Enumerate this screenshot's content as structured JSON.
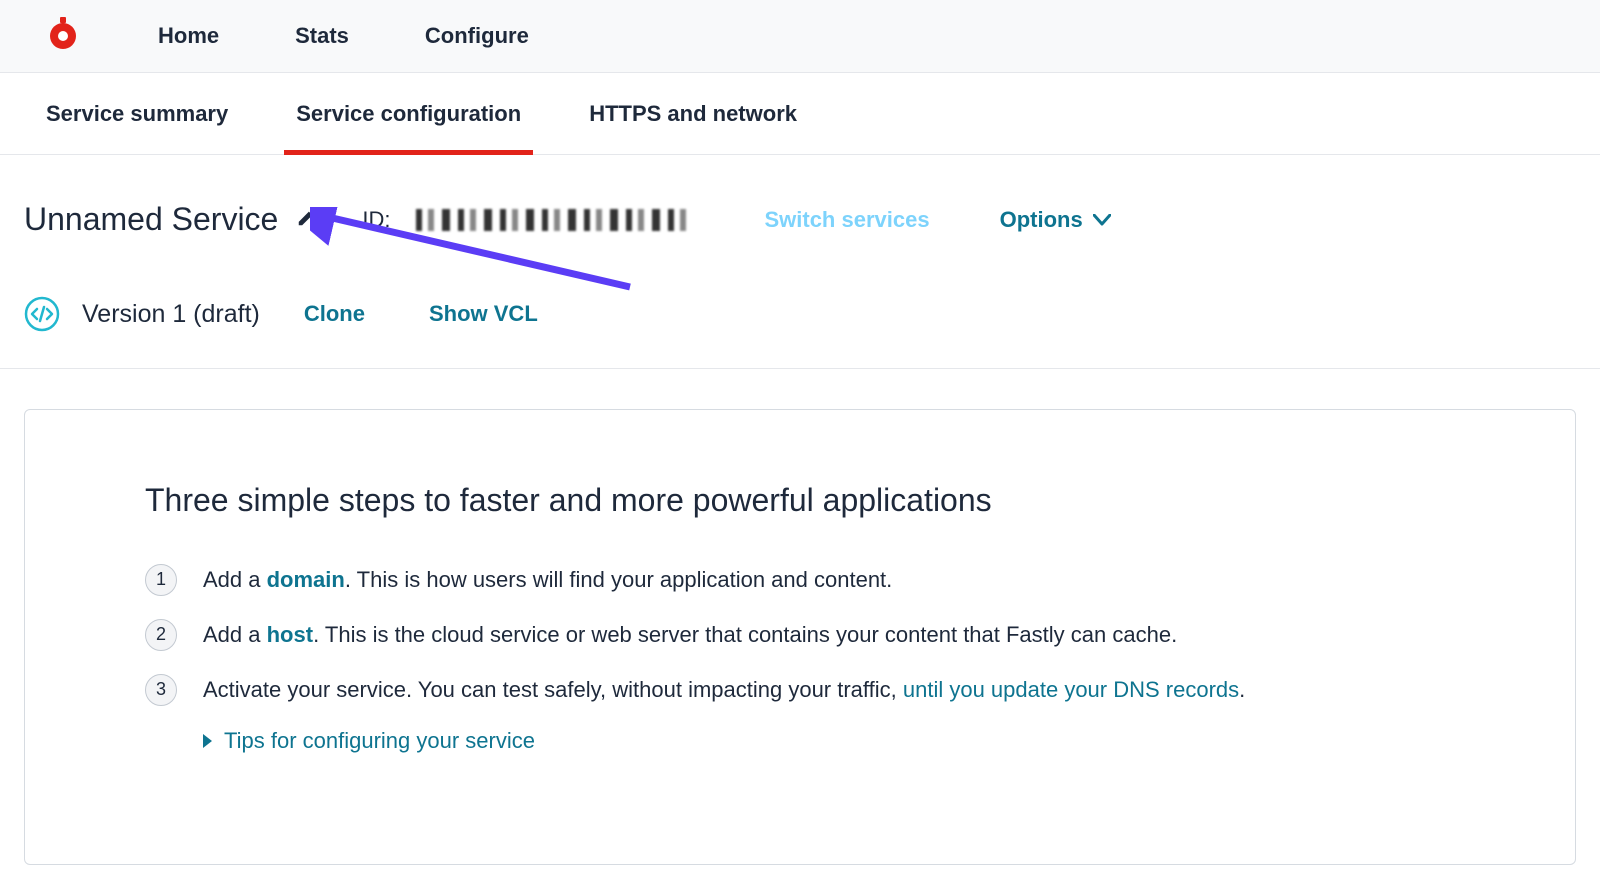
{
  "topNav": {
    "home": "Home",
    "stats": "Stats",
    "configure": "Configure"
  },
  "subTabs": {
    "summary": "Service summary",
    "config": "Service configuration",
    "https": "HTTPS and network"
  },
  "service": {
    "name": "Unnamed Service",
    "idLabel": "ID:",
    "switch": "Switch services",
    "options": "Options"
  },
  "version": {
    "label": "Version 1 (draft)",
    "clone": "Clone",
    "showVcl": "Show VCL"
  },
  "content": {
    "title": "Three simple steps to faster and more powerful applications",
    "step1_a": "Add a ",
    "step1_link": "domain",
    "step1_b": ". This is how users will find your application and content.",
    "step2_a": "Add a ",
    "step2_link": "host",
    "step2_b": ". This is the cloud service or web server that contains your content that Fastly can cache.",
    "step3_a": "Activate your service. You can test safely, without impacting your traffic, ",
    "step3_link": "until you update your DNS records",
    "step3_b": ".",
    "tips": "Tips for configuring your service",
    "num1": "1",
    "num2": "2",
    "num3": "3"
  }
}
